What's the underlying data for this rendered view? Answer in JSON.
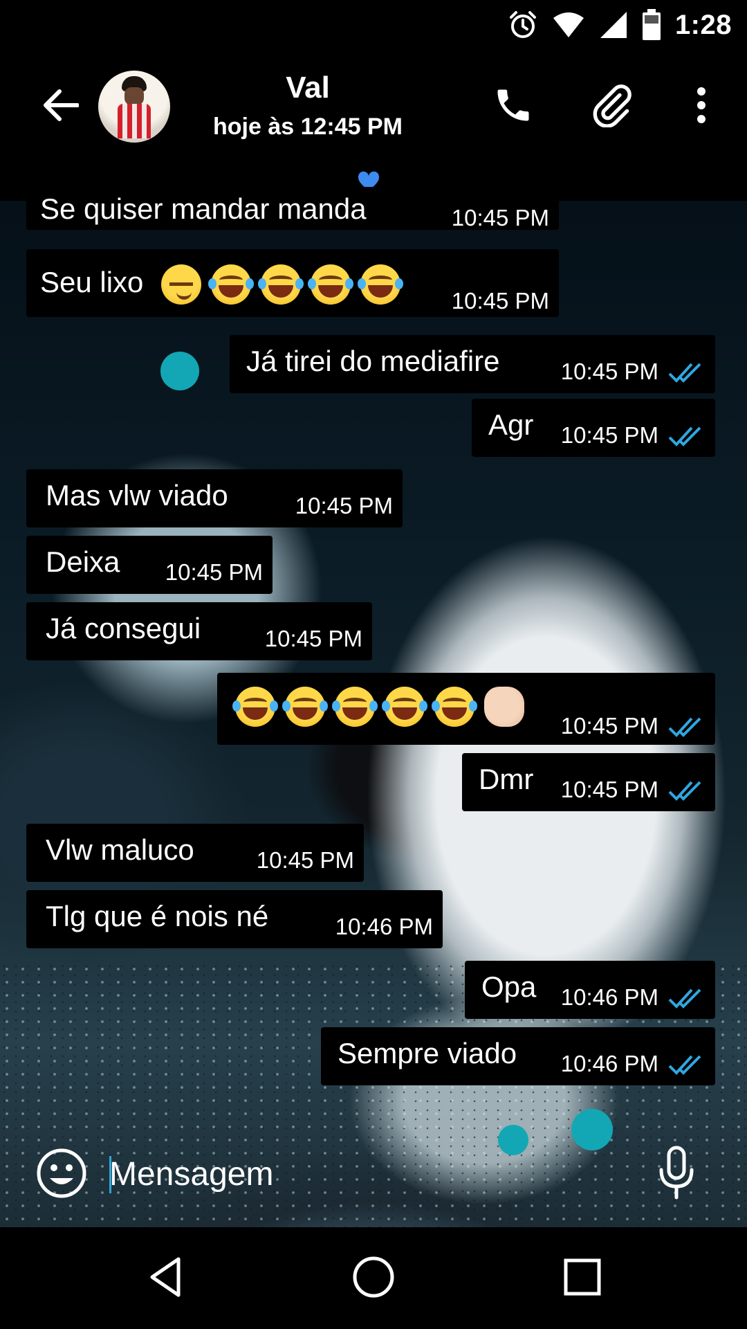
{
  "status_bar": {
    "time": "1:28"
  },
  "header": {
    "contact_name": "Val",
    "last_seen": "hoje às 12:45 PM"
  },
  "colors": {
    "accent_tick": "#2fa7e0",
    "bubble": "#000000",
    "heart": "#3d8bef"
  },
  "messages": [
    {
      "direction": "in",
      "text": "Se quiser mandar manda",
      "time": "10:45 PM"
    },
    {
      "direction": "in",
      "text": "Seu lixo",
      "emojis": [
        "smirk",
        "laugh",
        "laugh",
        "laugh",
        "laugh"
      ],
      "time": "10:45 PM"
    },
    {
      "direction": "out",
      "text": "Já tirei do mediafire",
      "time": "10:45 PM"
    },
    {
      "direction": "out",
      "text": "Agr",
      "time": "10:45 PM"
    },
    {
      "direction": "in",
      "text": "Mas vlw viado",
      "time": "10:45 PM"
    },
    {
      "direction": "in",
      "text": "Deixa",
      "time": "10:45 PM"
    },
    {
      "direction": "in",
      "text": "Já consegui",
      "time": "10:45 PM"
    },
    {
      "direction": "out",
      "text": "",
      "emojis": [
        "laugh",
        "laugh",
        "laugh",
        "laugh",
        "laugh",
        "fist"
      ],
      "time": "10:45 PM"
    },
    {
      "direction": "out",
      "text": "Dmr",
      "time": "10:45 PM"
    },
    {
      "direction": "in",
      "text": "Vlw maluco",
      "time": "10:45 PM"
    },
    {
      "direction": "in",
      "text": "Tlg que é nois né",
      "time": "10:46 PM"
    },
    {
      "direction": "out",
      "text": "Opa",
      "time": "10:46 PM"
    },
    {
      "direction": "out",
      "text": "Sempre viado",
      "time": "10:46 PM"
    }
  ],
  "input": {
    "placeholder": "Mensagem"
  }
}
